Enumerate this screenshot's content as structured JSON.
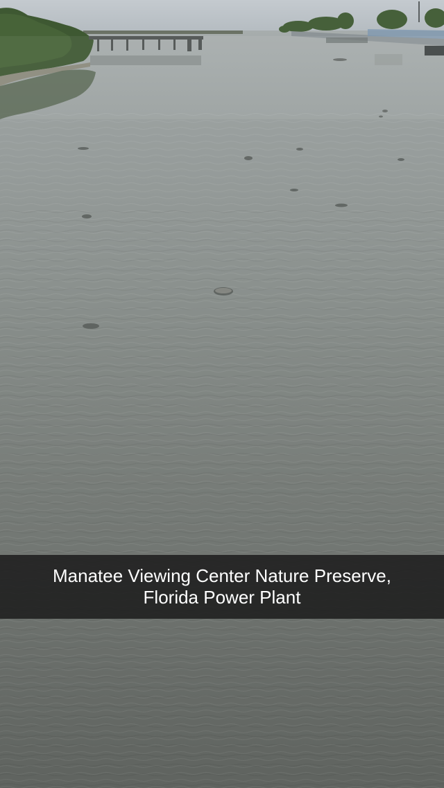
{
  "caption": {
    "line1": "Manatee Viewing Center Nature Preserve,",
    "line2": "Florida Power Plant"
  },
  "colors": {
    "sky": "#b9c0c6",
    "water_far": "#9ea4a4",
    "water_mid": "#7f8582",
    "water_near": "#6a6e69",
    "mangroves": "#3f5a32",
    "caption_bar": "#1e1e1e",
    "caption_text": "#ffffff"
  }
}
